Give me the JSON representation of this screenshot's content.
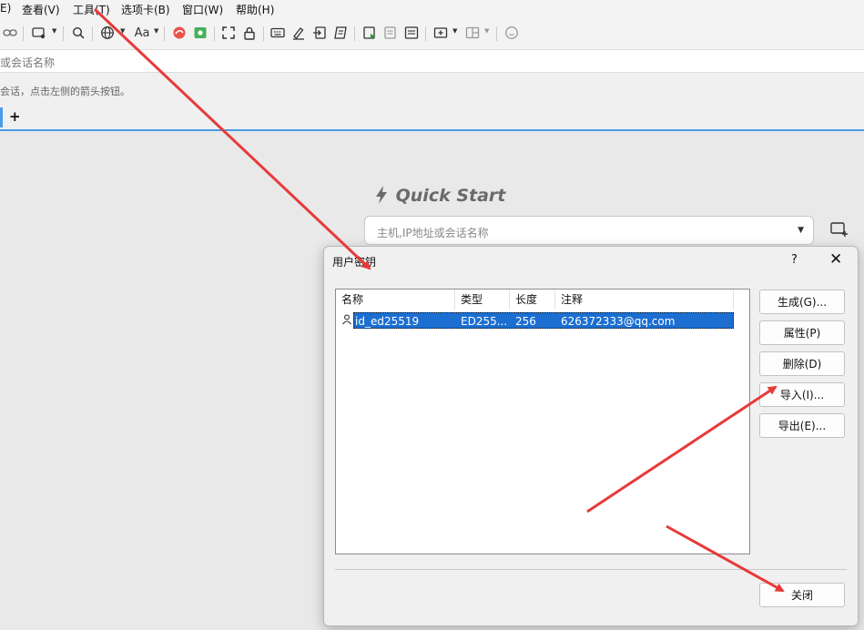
{
  "menubar": {
    "items": [
      "E)",
      "查看(V)",
      "工具(T)",
      "选项卡(B)",
      "窗口(W)",
      "帮助(H)"
    ]
  },
  "toolbar": {
    "icons": [
      "link-icon",
      "new-session-icon",
      "search-icon",
      "globe-icon",
      "font-icon",
      "xftp-icon",
      "xshell-icon",
      "fullscreen-icon",
      "lock-icon",
      "keyboard-icon",
      "compose-icon",
      "send-icon",
      "script-icon",
      "run-icon",
      "log-icon",
      "notes-icon",
      "new-tab-icon",
      "layout-icon",
      "chat-icon"
    ],
    "font_label": "Aa"
  },
  "address": {
    "placeholder": "或会话名称"
  },
  "hint": {
    "text": "会话，点击左侧的箭头按钮。"
  },
  "tabbar": {
    "add_label": "+"
  },
  "quick_start": {
    "title": "Quick Start",
    "placeholder": "主机,IP地址或会话名称"
  },
  "dialog": {
    "title": "用户密钥",
    "help": "?",
    "close": "✕",
    "columns": [
      "名称",
      "类型",
      "长度",
      "注释"
    ],
    "rows": [
      {
        "name": "id_ed25519",
        "type": "ED255...",
        "length": "256",
        "comment": "626372333@qq.com",
        "selected": true
      }
    ],
    "buttons": {
      "generate": "生成(G)...",
      "properties": "属性(P)",
      "delete": "删除(D)",
      "import": "导入(I)...",
      "export": "导出(E)...",
      "close": "关闭"
    }
  },
  "colors": {
    "accent": "#4a9be8",
    "selection": "#1c6fd1",
    "arrow": "#e83a3a"
  }
}
